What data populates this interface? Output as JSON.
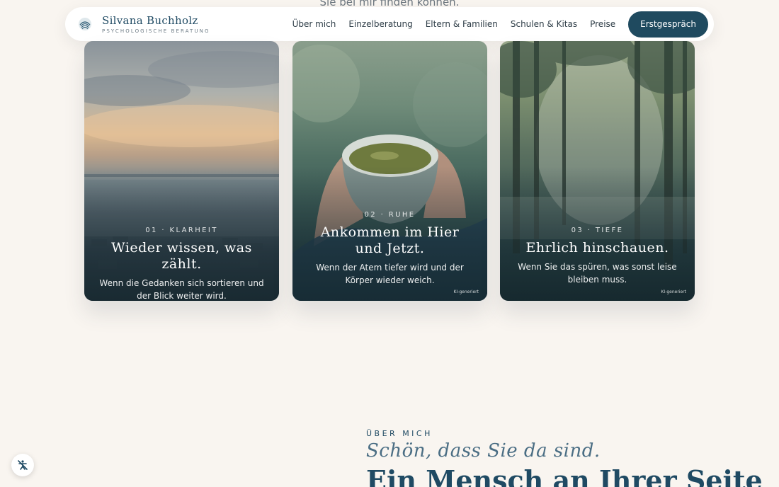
{
  "intro": {
    "cut_text": "Sie bei mir finden können."
  },
  "brand": {
    "name": "Silvana Buchholz",
    "subtitle": "PSYCHOLOGISCHE BERATUNG"
  },
  "nav": {
    "links": [
      "Über mich",
      "Einzelberatung",
      "Eltern & Familien",
      "Schulen & Kitas",
      "Preise"
    ],
    "cta": "Erstgespräch"
  },
  "cards": [
    {
      "kicker": "01 · KLARHEIT",
      "title": "Wieder wissen, was zählt.",
      "text": "Wenn die Gedanken sich sortieren und der Blick weiter wird.",
      "badge": ""
    },
    {
      "kicker": "02 · RUHE",
      "title": "Ankommen im Hier und Jetzt.",
      "text": "Wenn der Atem tiefer wird und der Körper wieder weich.",
      "badge": "KI-generiert"
    },
    {
      "kicker": "03 · TIEFE",
      "title": "Ehrlich hinschauen.",
      "text": "Wenn Sie das spüren, was sonst leise bleiben muss.",
      "badge": "KI-generiert"
    }
  ],
  "about": {
    "kicker": "ÜBER MICH",
    "script": "Schön, dass Sie da sind.",
    "title": "Ein Mensch an Ihrer Seite"
  },
  "icons": {
    "logo": "shell-logo-icon",
    "accessibility": "accessibility-off-icon"
  },
  "colors": {
    "primary": "#1f4a5f",
    "background": "#f9f5f0"
  }
}
